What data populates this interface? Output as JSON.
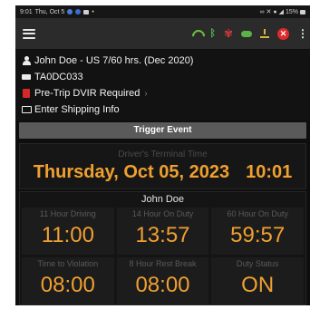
{
  "status_bar": {
    "time": "9:01",
    "date": "Thu, Oct 5",
    "battery": "15%"
  },
  "app_bar": {
    "icons": [
      "menu-icon",
      "wifi-icon",
      "bluetooth-icon",
      "engine-fan-icon",
      "cloud-icon",
      "download-icon",
      "sync-error-icon",
      "more-vert-icon"
    ],
    "colors": {
      "wifi": "#6cbf3c",
      "bluetooth": "#4fb04a",
      "fan": "#d83a3a",
      "cloud": "#5bb24a",
      "download": "#d4b63a",
      "error": "#e02a2a"
    }
  },
  "info": {
    "driver_line": "John Doe - US 7/60 hrs. (Dec 2020)",
    "vehicle": "TA0DC033",
    "dvir": "Pre-Trip DVIR Required",
    "shipping": "Enter Shipping Info"
  },
  "trigger_event": {
    "label": "Trigger Event"
  },
  "terminal_time": {
    "caption": "Driver's Terminal Time",
    "date": "Thursday, Oct 05, 2023",
    "time": "10:01",
    "accent": "#f0a030"
  },
  "hours": {
    "driver_name": "John Doe",
    "cells": [
      {
        "label": "11 Hour Driving",
        "value": "11:00"
      },
      {
        "label": "14 Hour On Duty",
        "value": "13:57"
      },
      {
        "label": "60 Hour On Duty",
        "value": "59:57"
      },
      {
        "label": "Time to Violation",
        "value": "08:00"
      },
      {
        "label": "8 Hour Rest Break",
        "value": "08:00"
      },
      {
        "label": "Duty Status",
        "value": "ON"
      }
    ]
  }
}
